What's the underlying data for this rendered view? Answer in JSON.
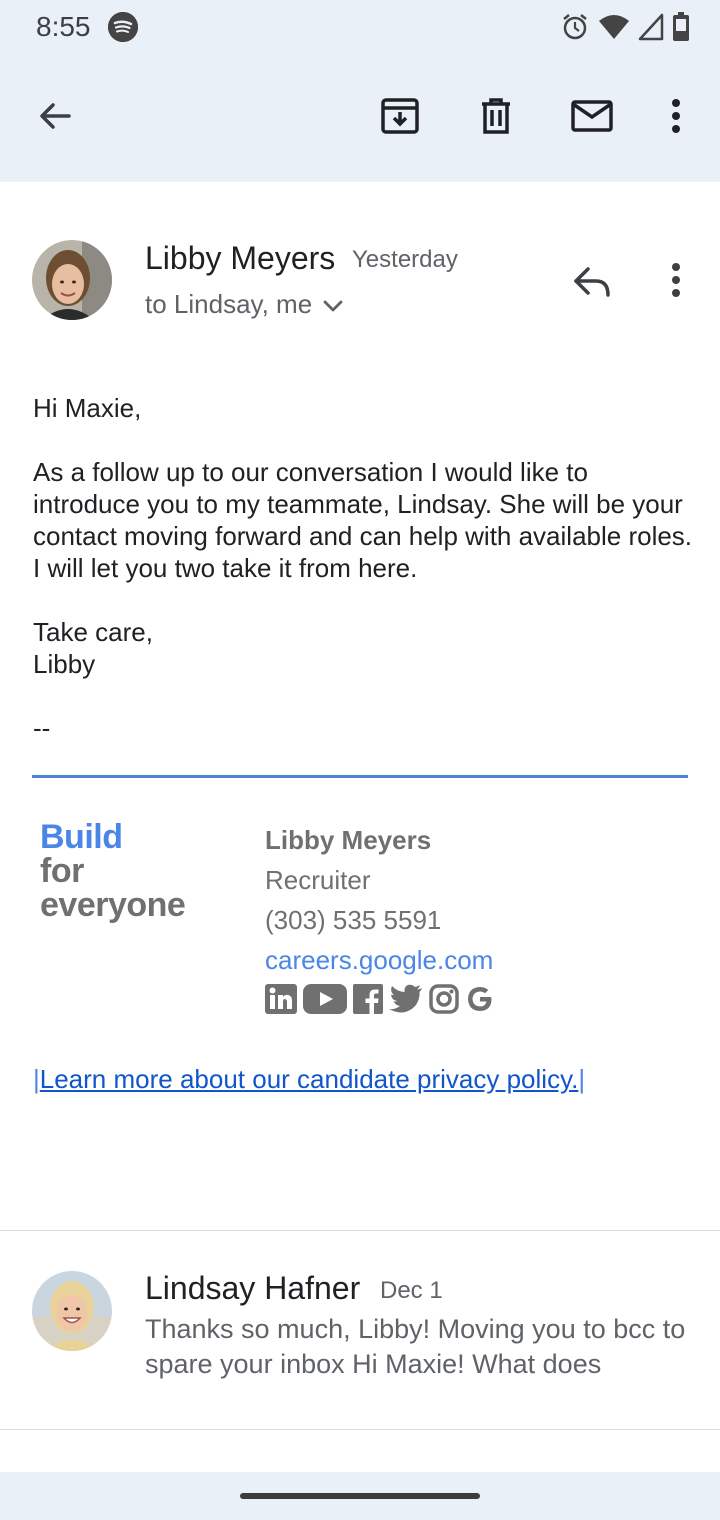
{
  "status_bar": {
    "time": "8:55",
    "icons": [
      "spotify-icon",
      "alarm-icon",
      "wifi-icon",
      "cell-signal-icon",
      "battery-icon"
    ]
  },
  "toolbar": {
    "icons": [
      "back-arrow-icon",
      "archive-icon",
      "delete-icon",
      "mark-unread-icon",
      "more-vert-icon"
    ]
  },
  "message": {
    "sender": "Libby Meyers",
    "date": "Yesterday",
    "recipients": "to Lindsay, me",
    "body": {
      "greeting": "Hi Maxie,",
      "paragraph": "As a follow up to our conversation I would like to introduce you to my teammate, Lindsay. She will be your contact moving forward and can help with available roles. I will let you two take it from here.",
      "closing_line1": "Take care,",
      "closing_line2": "Libby",
      "separator": "--"
    },
    "signature": {
      "logo_line1": "Build",
      "logo_line2": "for",
      "logo_line3": "everyone",
      "name": "Libby Meyers",
      "title": "Recruiter",
      "phone": "(303) 535 5591",
      "website": "careers.google.com",
      "social_icons": [
        "linkedin-icon",
        "youtube-icon",
        "facebook-icon",
        "twitter-icon",
        "instagram-icon",
        "google-icon"
      ]
    },
    "privacy": {
      "bar_left": "|",
      "link_text": "Learn more about our candidate privacy policy.",
      "bar_right": "|"
    }
  },
  "thread_item": {
    "sender": "Lindsay Hafner",
    "date": "Dec 1",
    "snippet": "Thanks so much, Libby! Moving you to bcc to spare your inbox Hi Maxie! What does"
  },
  "colors": {
    "chrome_bg": "#eaf0f8",
    "accent_blue": "#4a86e8",
    "link_blue": "#1155cc",
    "secondary_text": "#5f6368"
  }
}
